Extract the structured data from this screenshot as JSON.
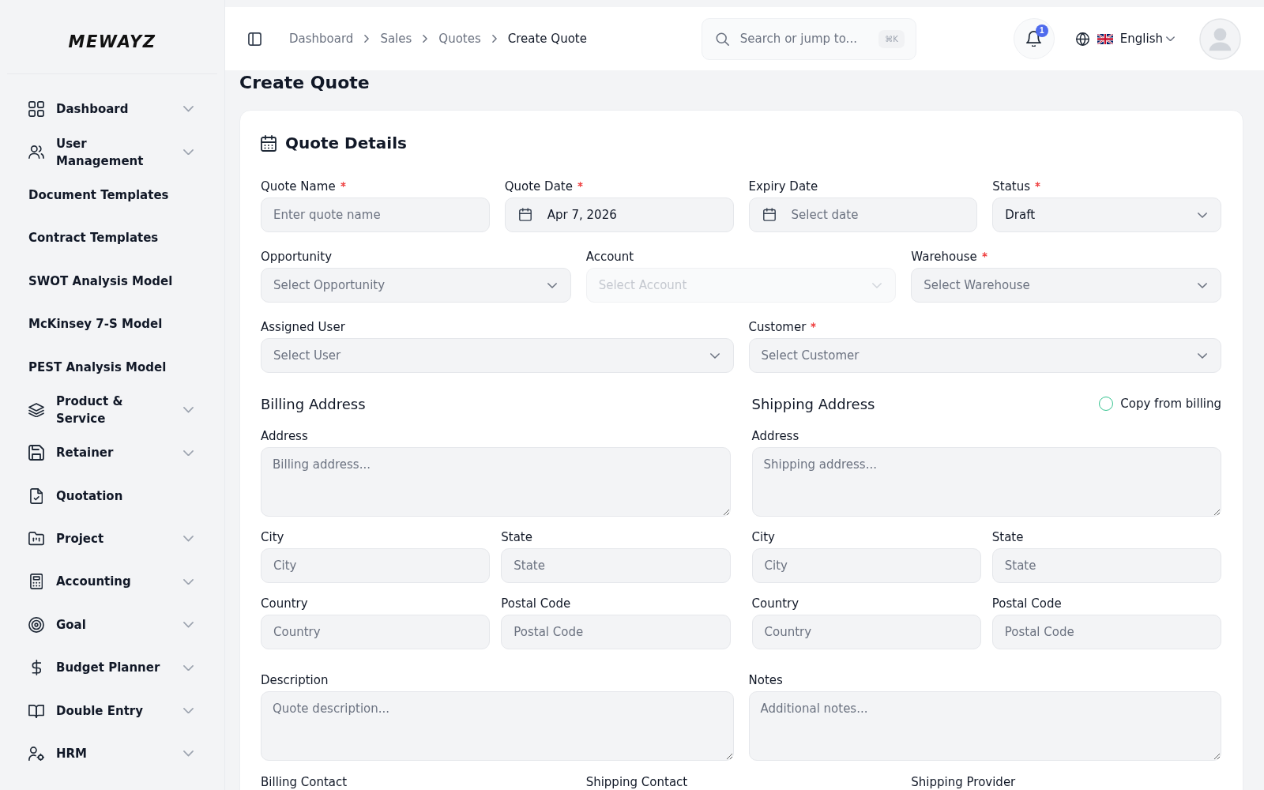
{
  "sidebar": {
    "logo": "MEWAYZ",
    "items": [
      {
        "label": "Dashboard",
        "expandable": true
      },
      {
        "label": "User Management",
        "expandable": true
      },
      {
        "label": "Document Templates",
        "expandable": false
      },
      {
        "label": "Contract Templates",
        "expandable": false
      },
      {
        "label": "SWOT Analysis Model",
        "expandable": false
      },
      {
        "label": "McKinsey 7-S Model",
        "expandable": false
      },
      {
        "label": "PEST Analysis Model",
        "expandable": false
      },
      {
        "label": "Product & Service",
        "expandable": true
      },
      {
        "label": "Retainer",
        "expandable": true
      },
      {
        "label": "Quotation",
        "expandable": false
      },
      {
        "label": "Project",
        "expandable": true
      },
      {
        "label": "Accounting",
        "expandable": true
      },
      {
        "label": "Goal",
        "expandable": true
      },
      {
        "label": "Budget Planner",
        "expandable": true
      },
      {
        "label": "Double Entry",
        "expandable": true
      },
      {
        "label": "HRM",
        "expandable": true
      }
    ]
  },
  "header": {
    "breadcrumbs": [
      {
        "label": "Dashboard",
        "current": false
      },
      {
        "label": "Sales",
        "current": false
      },
      {
        "label": "Quotes",
        "current": false
      },
      {
        "label": "Create Quote",
        "current": true
      }
    ],
    "search": {
      "placeholder": "Search or jump to...",
      "shortcut": "⌘K"
    },
    "notifications": {
      "count": "1"
    },
    "language": {
      "label": "English"
    }
  },
  "page_title": "Create Quote",
  "quote_details": {
    "title": "Quote Details",
    "groups": [
      {
        "fields": [
          {
            "kind": "text",
            "label": "Quote Name",
            "required": true,
            "disabled": false,
            "placeholder": "Enter quote name"
          },
          {
            "kind": "date",
            "label": "Quote Date",
            "required": true,
            "disabled": false,
            "value": "Apr 7, 2026"
          },
          {
            "kind": "date",
            "label": "Expiry Date",
            "required": false,
            "disabled": false,
            "placeholder": "Select date"
          },
          {
            "kind": "select",
            "label": "Status",
            "required": true,
            "disabled": false,
            "value": "Draft"
          }
        ]
      },
      {
        "fields": [
          {
            "kind": "select",
            "label": "Opportunity",
            "required": false,
            "disabled": false,
            "placeholder": "Select Opportunity"
          },
          {
            "kind": "select",
            "label": "Account",
            "required": false,
            "disabled": true,
            "placeholder": "Select Account"
          },
          {
            "kind": "select",
            "label": "Warehouse",
            "required": true,
            "disabled": false,
            "placeholder": "Select Warehouse"
          }
        ]
      },
      {
        "fields": [
          {
            "kind": "select",
            "label": "Assigned User",
            "required": false,
            "disabled": false,
            "placeholder": "Select User"
          },
          {
            "kind": "select",
            "label": "Customer",
            "required": true,
            "disabled": false,
            "placeholder": "Select Customer"
          }
        ]
      }
    ]
  },
  "billing_address": {
    "title": "Billing Address",
    "fields": [
      {
        "kind": "textarea",
        "label": "Address",
        "required": false,
        "placeholder": "Billing address..."
      },
      {
        "kind": "text",
        "label": "City",
        "required": false,
        "placeholder": "City"
      },
      {
        "kind": "text",
        "label": "State",
        "required": false,
        "placeholder": "State"
      },
      {
        "kind": "text",
        "label": "Country",
        "required": false,
        "placeholder": "Country"
      },
      {
        "kind": "text",
        "label": "Postal Code",
        "required": false,
        "placeholder": "Postal Code"
      }
    ]
  },
  "shipping_address": {
    "title": "Shipping Address",
    "copy_from_billing": {
      "label": "Copy from billing",
      "checked": false
    },
    "fields": [
      {
        "kind": "textarea",
        "label": "Address",
        "required": false,
        "placeholder": "Shipping address..."
      },
      {
        "kind": "text",
        "label": "City",
        "required": false,
        "placeholder": "City"
      },
      {
        "kind": "text",
        "label": "State",
        "required": false,
        "placeholder": "State"
      },
      {
        "kind": "text",
        "label": "Country",
        "required": false,
        "placeholder": "Country"
      },
      {
        "kind": "text",
        "label": "Postal Code",
        "required": false,
        "placeholder": "Postal Code"
      }
    ]
  },
  "notes_fields": [
    {
      "kind": "textarea",
      "label": "Description",
      "required": false,
      "placeholder": "Quote description..."
    },
    {
      "kind": "textarea",
      "label": "Notes",
      "required": false,
      "placeholder": "Additional notes..."
    }
  ],
  "contact_fields": [
    {
      "label": "Billing Contact",
      "required": false
    },
    {
      "label": "Shipping Contact",
      "required": false
    },
    {
      "label": "Shipping Provider",
      "required": false
    }
  ]
}
